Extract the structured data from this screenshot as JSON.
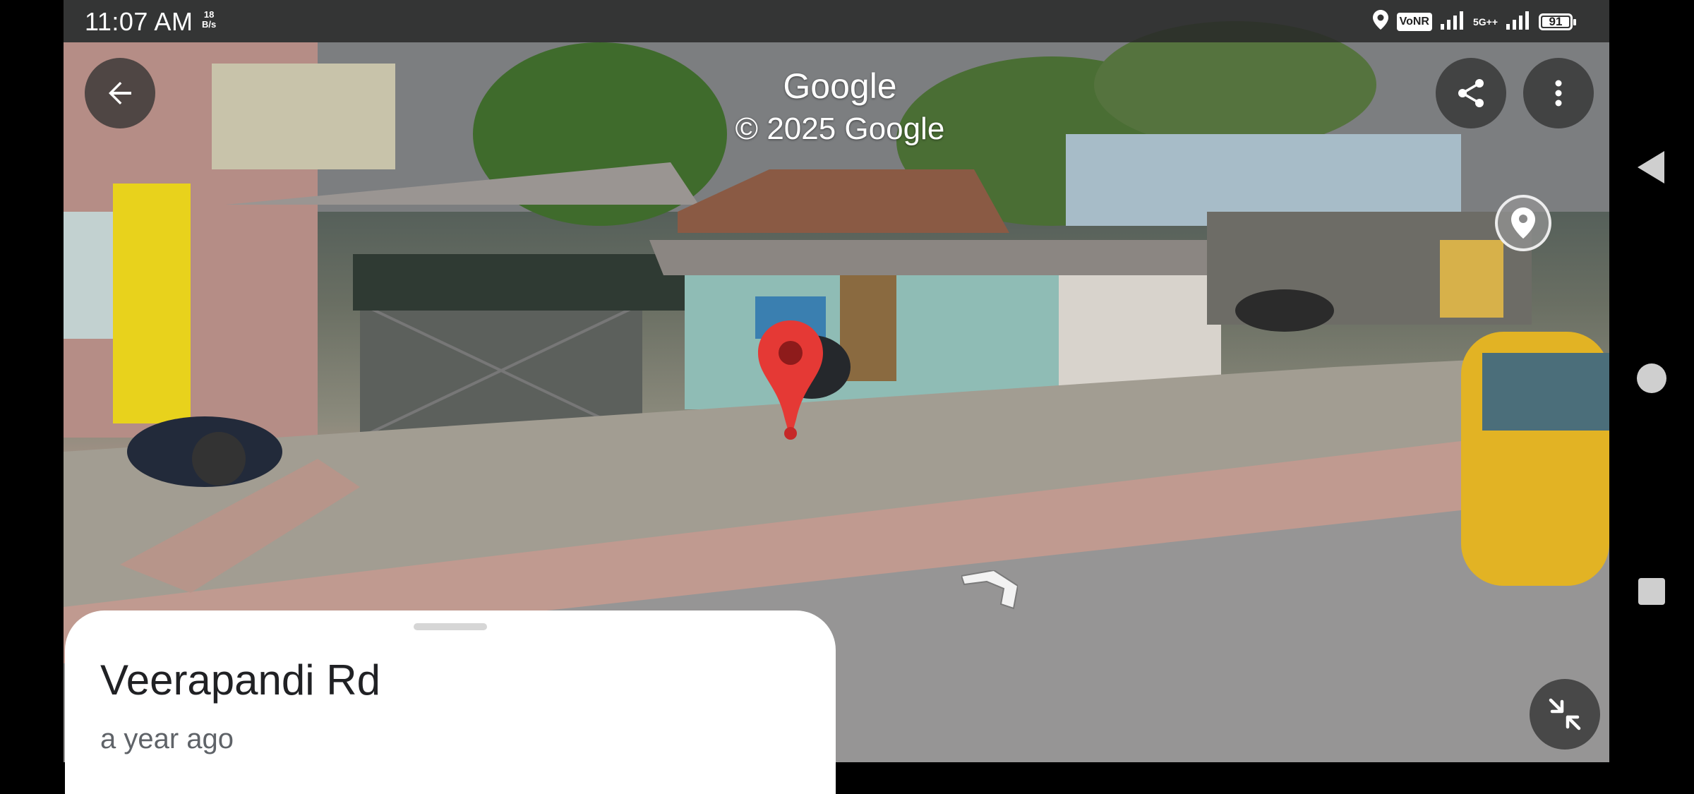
{
  "status_bar": {
    "time": "11:07 AM",
    "speed_value": "18",
    "speed_unit": "B/s",
    "vonr": "VoNR",
    "network_5g": "5G++",
    "battery": "91"
  },
  "attribution": {
    "brand": "Google",
    "copyright": "© 2025 Google"
  },
  "place": {
    "title": "Veerapandi Rd",
    "date": "a year ago"
  },
  "icons": {
    "back": "arrow-back-icon",
    "share": "share-icon",
    "more": "more-vert-icon",
    "street_view": "location-pin-icon",
    "exit_fullscreen": "exit-fullscreen-icon",
    "marker": "red-map-marker",
    "nav_arrow": "street-view-direction-arrow"
  },
  "colors": {
    "marker_red": "#e53935",
    "overlay_button": "#323232",
    "sheet_bg": "#ffffff",
    "title_text": "#202124",
    "subtitle_text": "#5f6368"
  }
}
